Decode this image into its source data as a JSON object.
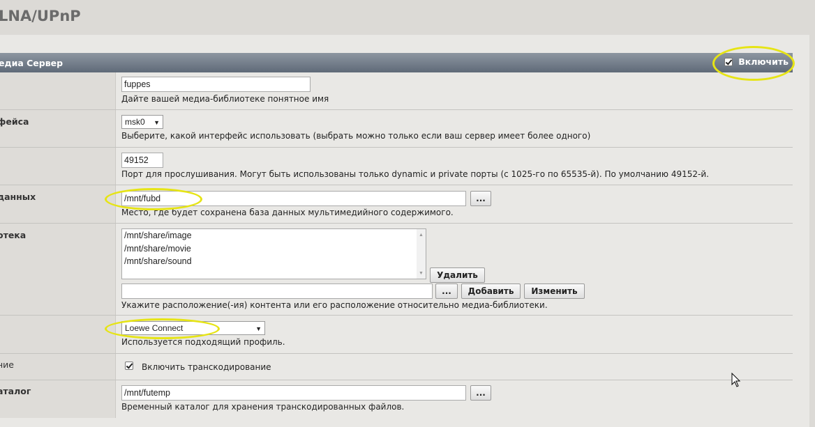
{
  "page_title": "LNA/UPnP",
  "section": {
    "title": "едиа Сервер",
    "enable_label": "Включить",
    "enable_checked": true
  },
  "rows": {
    "name": {
      "label": "",
      "value": "fuppes",
      "hint": "Дайте вашей медиа-библиотеке понятное имя"
    },
    "interface": {
      "label": "фейса",
      "selected": "msk0",
      "hint": "Выберите, какой интерфейс использовать (выбрать можно только если ваш сервер имеет более одного)"
    },
    "port": {
      "label": "",
      "value": "49152",
      "hint": "Порт для прослушивания. Могут быть использованы только dynamic и private порты (с 1025-го по 65535-й). По умолчанию 49152-й."
    },
    "database": {
      "label": "данных",
      "value": "/mnt/fubd",
      "browse_label": "...",
      "hint": "Место, где будет сохранена база данных мультимедийного содержимого."
    },
    "library": {
      "label": "отека",
      "items": [
        "/mnt/share/image",
        "/mnt/share/movie",
        "/mnt/share/sound"
      ],
      "delete_label": "Удалить",
      "new_value": "",
      "browse_label": "...",
      "add_label": "Добавить",
      "edit_label": "Изменить",
      "hint": "Укажите расположение(-ия) контента или его расположение относительно медиа-библиотеки."
    },
    "profile": {
      "label": "",
      "selected": "Loewe Connect",
      "hint": "Используется подходящий профиль."
    },
    "transcoding": {
      "label": "ние",
      "checkbox_label": "Включить транскодирование",
      "checked": true
    },
    "temp_dir": {
      "label": "аталог",
      "value": "/mnt/futemp",
      "browse_label": "...",
      "hint": "Временный каталог для хранения транскодированных файлов."
    }
  },
  "colors": {
    "highlight": "#e6e415",
    "header_top": "#8d96a1",
    "header_bottom": "#5f6a78"
  }
}
